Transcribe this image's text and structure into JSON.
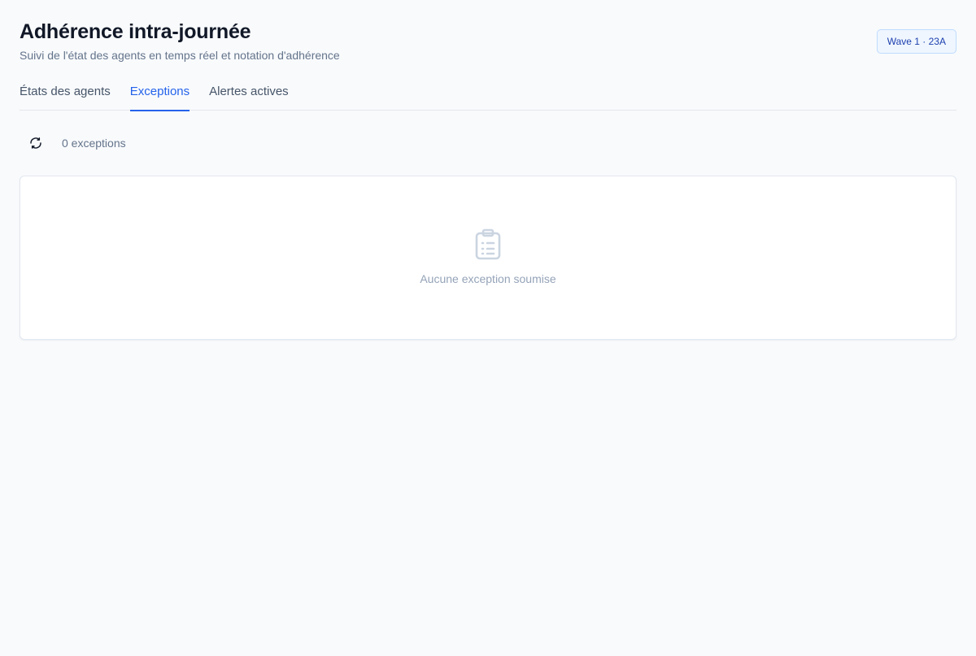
{
  "header": {
    "title": "Adhérence intra-journée",
    "subtitle": "Suivi de l'état des agents en temps réel et notation d'adhérence",
    "badge": "Wave 1 · 23A"
  },
  "tabs": [
    {
      "label": "États des agents",
      "active": false
    },
    {
      "label": "Exceptions",
      "active": true
    },
    {
      "label": "Alertes actives",
      "active": false
    }
  ],
  "toolbar": {
    "refresh_icon": "refresh-icon",
    "count_label": "0 exceptions"
  },
  "empty_state": {
    "icon": "clipboard-list-icon",
    "message": "Aucune exception soumise"
  },
  "colors": {
    "accent": "#2563eb",
    "background": "#f8fafc",
    "muted_text": "#64748b",
    "badge_background": "#eff6ff",
    "badge_border": "#bfdbfe"
  }
}
